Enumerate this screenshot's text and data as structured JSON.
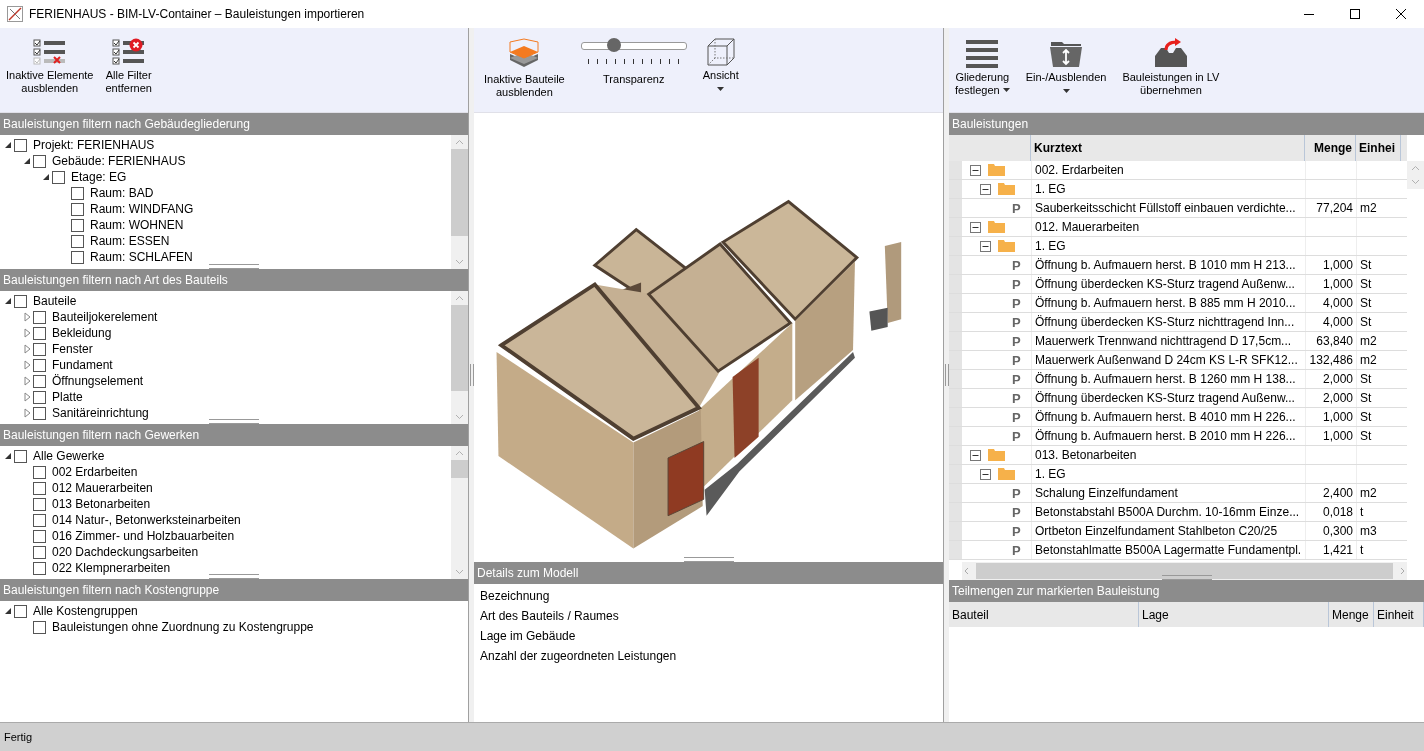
{
  "window": {
    "title": "FERIENHAUS - BIM-LV-Container – Bauleistungen importieren"
  },
  "left_toolbar": [
    {
      "kind": "hide-inactive",
      "label": "Inaktive Elemente\nausblenden"
    },
    {
      "kind": "remove-filters",
      "label": "Alle Filter\nentfernen"
    }
  ],
  "filters": [
    {
      "title": "Bauleistungen filtern nach Gebäudegliederung",
      "nodes": [
        {
          "label": "Projekt: FERIENHAUS",
          "checked": false,
          "expanded": true,
          "children": [
            {
              "label": "Gebäude: FERIENHAUS",
              "checked": false,
              "expanded": true,
              "children": [
                {
                  "label": "Etage: EG",
                  "checked": false,
                  "expanded": true,
                  "children": [
                    {
                      "label": "Raum: BAD",
                      "checked": false
                    },
                    {
                      "label": "Raum: WINDFANG",
                      "checked": false
                    },
                    {
                      "label": "Raum: WOHNEN",
                      "checked": false
                    },
                    {
                      "label": "Raum: ESSEN",
                      "checked": false
                    },
                    {
                      "label": "Raum: SCHLAFEN",
                      "checked": false
                    }
                  ]
                }
              ]
            }
          ]
        }
      ]
    },
    {
      "title": "Bauleistungen filtern nach Art des Bauteils",
      "nodes": [
        {
          "label": "Bauteile",
          "checked": false,
          "expanded": true,
          "children": [
            {
              "label": "Bauteiljokerelement",
              "checked": false,
              "expanded": false
            },
            {
              "label": "Bekleidung",
              "checked": false,
              "expanded": false
            },
            {
              "label": "Fenster",
              "checked": false,
              "expanded": false
            },
            {
              "label": "Fundament",
              "checked": false,
              "expanded": false
            },
            {
              "label": "Öffnungselement",
              "checked": false,
              "expanded": false
            },
            {
              "label": "Platte",
              "checked": false,
              "expanded": false
            },
            {
              "label": "Sanitäreinrichtung",
              "checked": false,
              "expanded": false
            }
          ]
        }
      ]
    },
    {
      "title": "Bauleistungen filtern nach Gewerken",
      "nodes": [
        {
          "label": "Alle Gewerke",
          "checked": false,
          "expanded": true,
          "children": [
            {
              "label": "002 Erdarbeiten",
              "checked": false
            },
            {
              "label": "012 Mauerarbeiten",
              "checked": false
            },
            {
              "label": "013 Betonarbeiten",
              "checked": false
            },
            {
              "label": "014 Natur-, Betonwerksteinarbeiten",
              "checked": false
            },
            {
              "label": "016 Zimmer- und Holzbauarbeiten",
              "checked": false
            },
            {
              "label": "020 Dachdeckungsarbeiten",
              "checked": false
            },
            {
              "label": "022 Klempnerarbeiten",
              "checked": false
            }
          ]
        }
      ]
    },
    {
      "title": "Bauleistungen filtern nach Kostengruppe",
      "nodes": [
        {
          "label": "Alle Kostengruppen",
          "checked": false,
          "expanded": true,
          "children": [
            {
              "label": "Bauleistungen ohne Zuordnung zu Kostengruppe",
              "checked": false
            }
          ]
        }
      ]
    }
  ],
  "viewer_toolbar": {
    "hide_button": {
      "label": "Inaktive Bauteile\nausblenden"
    },
    "transparency": {
      "label": "Transparenz",
      "level": 0.31
    },
    "view_button": {
      "label": "Ansicht",
      "dropdown": true
    }
  },
  "details": {
    "title": "Details zum Modell",
    "fields": [
      "Bezeichnung",
      "Art des Bauteils / Raumes",
      "Lage im Gebäude",
      "Anzahl der zugeordneten Leistungen"
    ]
  },
  "right_toolbar": [
    {
      "kind": "outline",
      "label": "Gliederung\nfestlegen",
      "dropdown": true
    },
    {
      "kind": "show-hide",
      "label": "Ein-/Ausblenden",
      "dropdown": true
    },
    {
      "kind": "transfer",
      "label": "Bauleistungen in LV\nübernehmen",
      "dropdown": false
    }
  ],
  "table": {
    "title": "Bauleistungen",
    "columns": [
      "Kurztext",
      "Menge",
      "Einhei"
    ],
    "rows": [
      {
        "kind": "group",
        "expanded": true,
        "text": "002. Erdarbeiten",
        "children": [
          {
            "kind": "group",
            "expanded": true,
            "text": "1. EG",
            "children": [
              {
                "kind": "position",
                "marker": "P",
                "text": "Sauberkeitsschicht Füllstoff einbauen verdichte...",
                "menge": "77,204",
                "einheit": "m2"
              }
            ]
          }
        ]
      },
      {
        "kind": "group",
        "expanded": true,
        "text": "012. Mauerarbeiten",
        "children": [
          {
            "kind": "group",
            "expanded": true,
            "text": "1. EG",
            "children": [
              {
                "kind": "position",
                "marker": "P",
                "text": "Öffnung b. Aufmauern herst. B 1010 mm H 213...",
                "menge": "1,000",
                "einheit": "St"
              },
              {
                "kind": "position",
                "marker": "P",
                "text": "Öffnung überdecken KS-Sturz tragend Außenw...",
                "menge": "1,000",
                "einheit": "St"
              },
              {
                "kind": "position",
                "marker": "P",
                "text": "Öffnung b. Aufmauern herst. B 885 mm H 2010...",
                "menge": "4,000",
                "einheit": "St"
              },
              {
                "kind": "position",
                "marker": "P",
                "text": "Öffnung überdecken KS-Sturz nichttragend Inn...",
                "menge": "4,000",
                "einheit": "St"
              },
              {
                "kind": "position",
                "marker": "P",
                "text": "Mauerwerk Trennwand nichttragend D 17,5cm...",
                "menge": "63,840",
                "einheit": "m2"
              },
              {
                "kind": "position",
                "marker": "P",
                "text": "Mauerwerk Außenwand D 24cm KS L-R SFK12...",
                "menge": "132,486",
                "einheit": "m2"
              },
              {
                "kind": "position",
                "marker": "P",
                "text": "Öffnung b. Aufmauern herst. B 1260 mm H 138...",
                "menge": "2,000",
                "einheit": "St"
              },
              {
                "kind": "position",
                "marker": "P",
                "text": "Öffnung überdecken KS-Sturz tragend Außenw...",
                "menge": "2,000",
                "einheit": "St"
              },
              {
                "kind": "position",
                "marker": "P",
                "text": "Öffnung b. Aufmauern herst. B 4010 mm H 226...",
                "menge": "1,000",
                "einheit": "St"
              },
              {
                "kind": "position",
                "marker": "P",
                "text": "Öffnung b. Aufmauern herst. B 2010 mm H 226...",
                "menge": "1,000",
                "einheit": "St"
              }
            ]
          }
        ]
      },
      {
        "kind": "group",
        "expanded": true,
        "text": "013. Betonarbeiten",
        "children": [
          {
            "kind": "group",
            "expanded": true,
            "text": "1. EG",
            "children": [
              {
                "kind": "position",
                "marker": "P",
                "text": "Schalung Einzelfundament",
                "menge": "2,400",
                "einheit": "m2"
              },
              {
                "kind": "position",
                "marker": "P",
                "text": "Betonstabstahl B500A Durchm. 10-16mm Einze...",
                "menge": "0,018",
                "einheit": "t"
              },
              {
                "kind": "position",
                "marker": "P",
                "text": "Ortbeton Einzelfundament Stahlbeton C20/25",
                "menge": "0,300",
                "einheit": "m3"
              },
              {
                "kind": "position",
                "marker": "P",
                "text": "Betonstahlmatte B500A Lagermatte Fundamentpl.",
                "menge": "1,421",
                "einheit": "t"
              }
            ]
          }
        ]
      }
    ]
  },
  "subtable": {
    "title": "Teilmengen zur markierten Bauleistung",
    "columns": [
      "Bauteil",
      "Lage",
      "Menge",
      "Einheit"
    ]
  },
  "status_bar": {
    "text": "Fertig"
  }
}
